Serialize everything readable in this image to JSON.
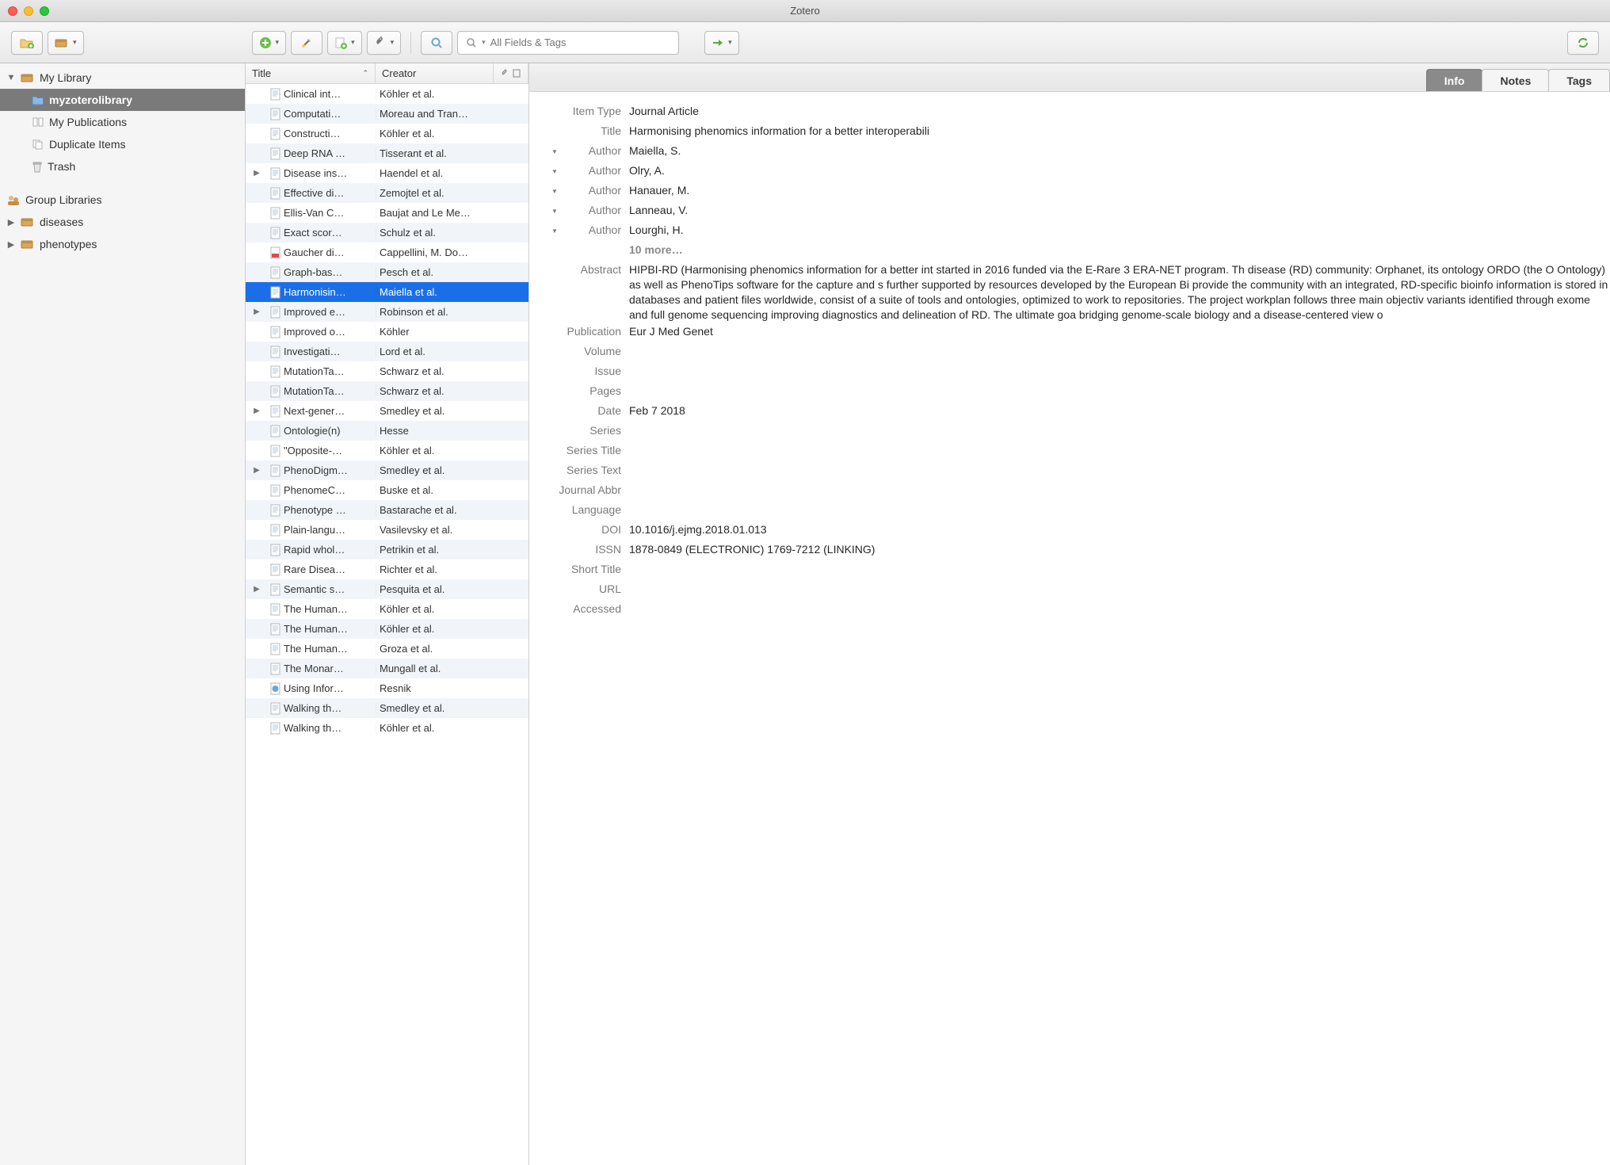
{
  "window": {
    "title": "Zotero"
  },
  "toolbar": {
    "search_placeholder": "All Fields & Tags"
  },
  "sidebar": {
    "my_library": "My Library",
    "items": [
      {
        "label": "myzoterolibrary",
        "selected": true
      },
      {
        "label": "My Publications"
      },
      {
        "label": "Duplicate Items"
      },
      {
        "label": "Trash"
      }
    ],
    "group_header": "Group Libraries",
    "groups": [
      {
        "label": "diseases"
      },
      {
        "label": "phenotypes"
      }
    ]
  },
  "list": {
    "col_title": "Title",
    "col_creator": "Creator",
    "rows": [
      {
        "title": "Clinical int…",
        "creator": "Köhler et al."
      },
      {
        "title": "Computati…",
        "creator": "Moreau and Tran…"
      },
      {
        "title": "Constructi…",
        "creator": "Köhler et al."
      },
      {
        "title": "Deep RNA …",
        "creator": "Tisserant et al."
      },
      {
        "title": "Disease ins…",
        "creator": "Haendel et al.",
        "expandable": true
      },
      {
        "title": "Effective di…",
        "creator": "Zemojtel et al."
      },
      {
        "title": "Ellis-Van C…",
        "creator": "Baujat and Le Me…"
      },
      {
        "title": "Exact scor…",
        "creator": "Schulz et al."
      },
      {
        "title": "Gaucher di…",
        "creator": "Cappellini, M. Do…",
        "icon": "pdf"
      },
      {
        "title": "Graph-bas…",
        "creator": "Pesch et al."
      },
      {
        "title": "Harmonisin…",
        "creator": "Maiella et al.",
        "selected": true
      },
      {
        "title": "Improved e…",
        "creator": "Robinson et al.",
        "expandable": true
      },
      {
        "title": "Improved o…",
        "creator": "Köhler"
      },
      {
        "title": "Investigati…",
        "creator": "Lord et al."
      },
      {
        "title": "MutationTa…",
        "creator": "Schwarz et al."
      },
      {
        "title": "MutationTa…",
        "creator": "Schwarz et al."
      },
      {
        "title": "Next-gener…",
        "creator": "Smedley et al.",
        "expandable": true
      },
      {
        "title": "Ontologie(n)",
        "creator": "Hesse"
      },
      {
        "title": "\"Opposite-…",
        "creator": "Köhler et al."
      },
      {
        "title": "PhenoDigm…",
        "creator": "Smedley et al.",
        "expandable": true
      },
      {
        "title": "PhenomeC…",
        "creator": "Buske et al."
      },
      {
        "title": "Phenotype …",
        "creator": "Bastarache et al."
      },
      {
        "title": "Plain-langu…",
        "creator": "Vasilevsky et al."
      },
      {
        "title": "Rapid whol…",
        "creator": "Petrikin et al."
      },
      {
        "title": "Rare Disea…",
        "creator": "Richter et al."
      },
      {
        "title": "Semantic s…",
        "creator": "Pesquita et al.",
        "expandable": true
      },
      {
        "title": "The Human…",
        "creator": "Köhler et al."
      },
      {
        "title": "The Human…",
        "creator": "Köhler et al."
      },
      {
        "title": "The Human…",
        "creator": "Groza et al."
      },
      {
        "title": "The Monar…",
        "creator": "Mungall et al."
      },
      {
        "title": "Using Infor…",
        "creator": "Resnik",
        "icon": "web"
      },
      {
        "title": "Walking th…",
        "creator": "Smedley et al."
      },
      {
        "title": "Walking th…",
        "creator": "Köhler et al."
      }
    ]
  },
  "tabs": {
    "info": "Info",
    "notes": "Notes",
    "tags": "Tags"
  },
  "details": {
    "item_type_label": "Item Type",
    "item_type": "Journal Article",
    "title_label": "Title",
    "title": "Harmonising phenomics information for a better interoperabili",
    "author_label": "Author",
    "authors": [
      "Maiella, S.",
      "Olry, A.",
      "Hanauer, M.",
      "Lanneau, V.",
      "Lourghi, H."
    ],
    "more_authors": "10 more…",
    "abstract_label": "Abstract",
    "abstract": "HIPBI-RD (Harmonising phenomics information for a better int started in 2016 funded via the E-Rare 3 ERA-NET program. Th disease (RD) community: Orphanet, its ontology ORDO (the O Ontology) as well as PhenoTips software for the capture and s further supported by resources developed by the European Bi provide the community with an integrated, RD-specific bioinfo information is stored in databases and patient files worldwide, consist of a suite of tools and ontologies, optimized to work to repositories. The project workplan follows three main objectiv variants identified through exome and full genome sequencing improving diagnostics and delineation of RD. The ultimate goa bridging genome-scale biology and a disease-centered view o",
    "fields": [
      {
        "label": "Publication",
        "value": "Eur J Med Genet"
      },
      {
        "label": "Volume",
        "value": ""
      },
      {
        "label": "Issue",
        "value": ""
      },
      {
        "label": "Pages",
        "value": ""
      },
      {
        "label": "Date",
        "value": "Feb 7 2018"
      },
      {
        "label": "Series",
        "value": ""
      },
      {
        "label": "Series Title",
        "value": ""
      },
      {
        "label": "Series Text",
        "value": ""
      },
      {
        "label": "Journal Abbr",
        "value": ""
      },
      {
        "label": "Language",
        "value": ""
      },
      {
        "label": "DOI",
        "value": "10.1016/j.ejmg.2018.01.013"
      },
      {
        "label": "ISSN",
        "value": "1878-0849 (ELECTRONIC) 1769-7212 (LINKING)"
      },
      {
        "label": "Short Title",
        "value": ""
      },
      {
        "label": "URL",
        "value": ""
      },
      {
        "label": "Accessed",
        "value": ""
      }
    ]
  }
}
